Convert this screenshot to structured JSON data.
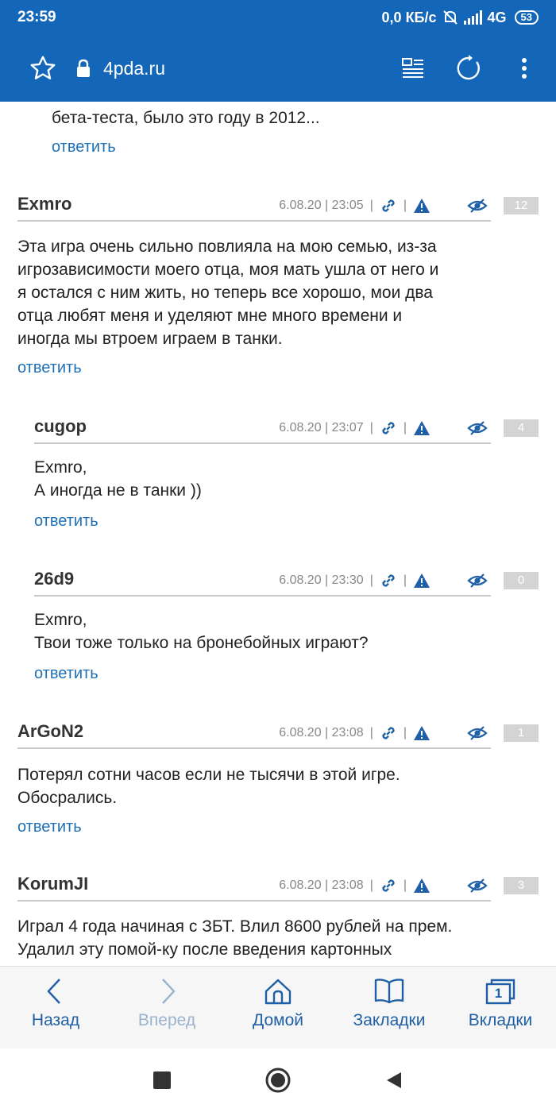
{
  "status_bar": {
    "time": "23:59",
    "net_speed": "0,0 КБ/с",
    "network": "4G",
    "battery": "53"
  },
  "browser": {
    "url": "4pda.ru"
  },
  "prev_comment": {
    "text": "бета-теста, было это году в 2012...",
    "reply": "ответить"
  },
  "posts": [
    {
      "author": "Exmro",
      "date": "6.08.20 | 23:05",
      "count": "12",
      "lines": [
        "Эта игра очень сильно повлияла на мою семью, из-за",
        "игрозависимости моего отца, моя мать ушла от него и",
        "я остался с ним жить, но теперь все хорошо, мои два",
        "отца любят меня и уделяют мне много времени и",
        "иногда мы втроем играем в танки."
      ],
      "reply": "ответить"
    },
    {
      "author": "cugop",
      "date": "6.08.20 | 23:07",
      "count": "4",
      "lines": [
        "Exmro,",
        "А иногда не в танки ))"
      ],
      "reply": "ответить"
    },
    {
      "author": "26d9",
      "date": "6.08.20 | 23:30",
      "count": "0",
      "lines": [
        "Exmro,",
        "Твои тоже только на бронебойных играют?"
      ],
      "reply": "ответить"
    },
    {
      "author": "ArGoN2",
      "date": "6.08.20 | 23:08",
      "count": "1",
      "lines": [
        "Потерял сотни часов если не тысячи в этой игре.",
        "Обосрались."
      ],
      "reply": "ответить"
    },
    {
      "author": "KorumJI",
      "date": "6.08.20 | 23:08",
      "count": "3",
      "lines": [
        "Играл 4 года начиная с ЗБТ. Влил 8600 рублей на прем.",
        "Удалил эту помой-ку после введения картонных"
      ]
    }
  ],
  "bottom_nav": {
    "back": "Назад",
    "forward": "Вперед",
    "home": "Домой",
    "bookmarks": "Закладки",
    "tabs": "Вкладки",
    "tabs_count": "1"
  },
  "colors": {
    "header": "#1467b8",
    "link": "#1f6fb5",
    "icon_blue": "#1f5fa6"
  }
}
